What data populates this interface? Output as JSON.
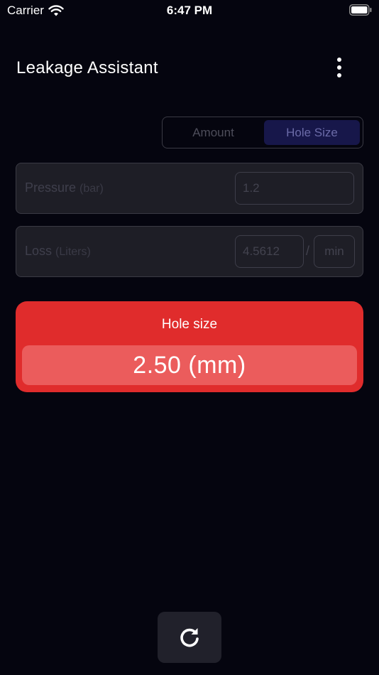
{
  "status_bar": {
    "carrier": "Carrier",
    "time": "6:47 PM"
  },
  "app_bar": {
    "title": "Leakage Assistant",
    "menu_icon": "more-vertical-icon"
  },
  "mode_toggle": {
    "options": [
      "Amount",
      "Hole Size"
    ],
    "selected": "Hole Size"
  },
  "pressure": {
    "label": "Pressure",
    "unit": "(bar)",
    "value": "1.2"
  },
  "loss": {
    "label": "Loss",
    "unit": "(Liters)",
    "value": "4.5612",
    "separator": "/",
    "per": "min"
  },
  "result": {
    "title": "Hole size",
    "value": "2.50 (mm)",
    "accent": "#e02c2c"
  },
  "actions": {
    "refresh_icon": "refresh-icon"
  }
}
